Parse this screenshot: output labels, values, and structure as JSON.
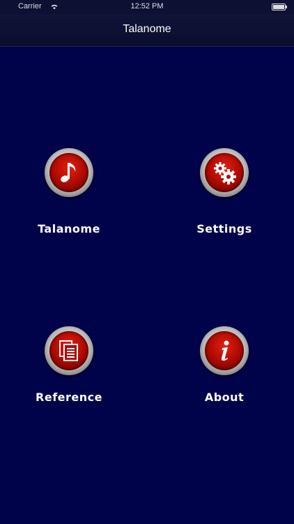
{
  "status_bar": {
    "carrier": "Carrier",
    "time": "12:52 PM",
    "battery_level": 1.0
  },
  "nav": {
    "title": "Talanome"
  },
  "menu": {
    "items": [
      {
        "label": "Talanome",
        "icon": "music-note-icon"
      },
      {
        "label": "Settings",
        "icon": "gears-icon"
      },
      {
        "label": "Reference",
        "icon": "documents-icon"
      },
      {
        "label": "About",
        "icon": "info-icon"
      }
    ]
  },
  "colors": {
    "background": "#00034a",
    "nav_background": "#0a0d2e",
    "button_red": "#b00a00",
    "label_text": "#ffffff"
  }
}
